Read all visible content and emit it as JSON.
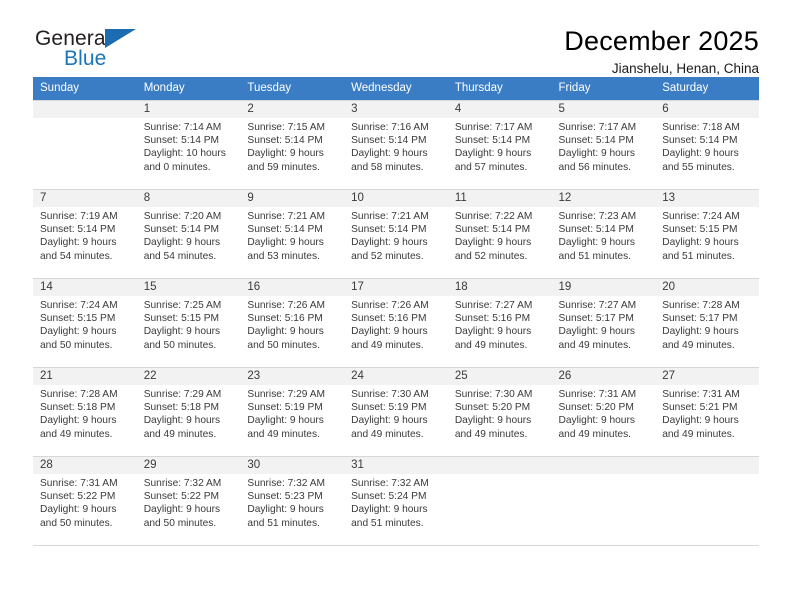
{
  "brand": {
    "name_part1": "General",
    "name_part2": "Blue",
    "flag_icon": "triangle-flag-icon"
  },
  "header": {
    "title": "December 2025",
    "subtitle": "Jianshelu, Henan, China"
  },
  "colors": {
    "header_row_bg": "#3b7dc4",
    "daynum_bg": "#f2f2f2",
    "brand_blue": "#1b75bb",
    "grid_line": "#d7d7d7",
    "text": "#3a3a3a"
  },
  "calendar": {
    "weekday_headers": [
      "Sunday",
      "Monday",
      "Tuesday",
      "Wednesday",
      "Thursday",
      "Friday",
      "Saturday"
    ],
    "labels": {
      "sunrise": "Sunrise:",
      "sunset": "Sunset:",
      "daylight": "Daylight:"
    },
    "weeks": [
      [
        {
          "day": "",
          "sunrise": "",
          "sunset": "",
          "daylight_line1": "",
          "daylight_line2": ""
        },
        {
          "day": "1",
          "sunrise": "Sunrise: 7:14 AM",
          "sunset": "Sunset: 5:14 PM",
          "daylight_line1": "Daylight: 10 hours",
          "daylight_line2": "and 0 minutes."
        },
        {
          "day": "2",
          "sunrise": "Sunrise: 7:15 AM",
          "sunset": "Sunset: 5:14 PM",
          "daylight_line1": "Daylight: 9 hours",
          "daylight_line2": "and 59 minutes."
        },
        {
          "day": "3",
          "sunrise": "Sunrise: 7:16 AM",
          "sunset": "Sunset: 5:14 PM",
          "daylight_line1": "Daylight: 9 hours",
          "daylight_line2": "and 58 minutes."
        },
        {
          "day": "4",
          "sunrise": "Sunrise: 7:17 AM",
          "sunset": "Sunset: 5:14 PM",
          "daylight_line1": "Daylight: 9 hours",
          "daylight_line2": "and 57 minutes."
        },
        {
          "day": "5",
          "sunrise": "Sunrise: 7:17 AM",
          "sunset": "Sunset: 5:14 PM",
          "daylight_line1": "Daylight: 9 hours",
          "daylight_line2": "and 56 minutes."
        },
        {
          "day": "6",
          "sunrise": "Sunrise: 7:18 AM",
          "sunset": "Sunset: 5:14 PM",
          "daylight_line1": "Daylight: 9 hours",
          "daylight_line2": "and 55 minutes."
        }
      ],
      [
        {
          "day": "7",
          "sunrise": "Sunrise: 7:19 AM",
          "sunset": "Sunset: 5:14 PM",
          "daylight_line1": "Daylight: 9 hours",
          "daylight_line2": "and 54 minutes."
        },
        {
          "day": "8",
          "sunrise": "Sunrise: 7:20 AM",
          "sunset": "Sunset: 5:14 PM",
          "daylight_line1": "Daylight: 9 hours",
          "daylight_line2": "and 54 minutes."
        },
        {
          "day": "9",
          "sunrise": "Sunrise: 7:21 AM",
          "sunset": "Sunset: 5:14 PM",
          "daylight_line1": "Daylight: 9 hours",
          "daylight_line2": "and 53 minutes."
        },
        {
          "day": "10",
          "sunrise": "Sunrise: 7:21 AM",
          "sunset": "Sunset: 5:14 PM",
          "daylight_line1": "Daylight: 9 hours",
          "daylight_line2": "and 52 minutes."
        },
        {
          "day": "11",
          "sunrise": "Sunrise: 7:22 AM",
          "sunset": "Sunset: 5:14 PM",
          "daylight_line1": "Daylight: 9 hours",
          "daylight_line2": "and 52 minutes."
        },
        {
          "day": "12",
          "sunrise": "Sunrise: 7:23 AM",
          "sunset": "Sunset: 5:14 PM",
          "daylight_line1": "Daylight: 9 hours",
          "daylight_line2": "and 51 minutes."
        },
        {
          "day": "13",
          "sunrise": "Sunrise: 7:24 AM",
          "sunset": "Sunset: 5:15 PM",
          "daylight_line1": "Daylight: 9 hours",
          "daylight_line2": "and 51 minutes."
        }
      ],
      [
        {
          "day": "14",
          "sunrise": "Sunrise: 7:24 AM",
          "sunset": "Sunset: 5:15 PM",
          "daylight_line1": "Daylight: 9 hours",
          "daylight_line2": "and 50 minutes."
        },
        {
          "day": "15",
          "sunrise": "Sunrise: 7:25 AM",
          "sunset": "Sunset: 5:15 PM",
          "daylight_line1": "Daylight: 9 hours",
          "daylight_line2": "and 50 minutes."
        },
        {
          "day": "16",
          "sunrise": "Sunrise: 7:26 AM",
          "sunset": "Sunset: 5:16 PM",
          "daylight_line1": "Daylight: 9 hours",
          "daylight_line2": "and 50 minutes."
        },
        {
          "day": "17",
          "sunrise": "Sunrise: 7:26 AM",
          "sunset": "Sunset: 5:16 PM",
          "daylight_line1": "Daylight: 9 hours",
          "daylight_line2": "and 49 minutes."
        },
        {
          "day": "18",
          "sunrise": "Sunrise: 7:27 AM",
          "sunset": "Sunset: 5:16 PM",
          "daylight_line1": "Daylight: 9 hours",
          "daylight_line2": "and 49 minutes."
        },
        {
          "day": "19",
          "sunrise": "Sunrise: 7:27 AM",
          "sunset": "Sunset: 5:17 PM",
          "daylight_line1": "Daylight: 9 hours",
          "daylight_line2": "and 49 minutes."
        },
        {
          "day": "20",
          "sunrise": "Sunrise: 7:28 AM",
          "sunset": "Sunset: 5:17 PM",
          "daylight_line1": "Daylight: 9 hours",
          "daylight_line2": "and 49 minutes."
        }
      ],
      [
        {
          "day": "21",
          "sunrise": "Sunrise: 7:28 AM",
          "sunset": "Sunset: 5:18 PM",
          "daylight_line1": "Daylight: 9 hours",
          "daylight_line2": "and 49 minutes."
        },
        {
          "day": "22",
          "sunrise": "Sunrise: 7:29 AM",
          "sunset": "Sunset: 5:18 PM",
          "daylight_line1": "Daylight: 9 hours",
          "daylight_line2": "and 49 minutes."
        },
        {
          "day": "23",
          "sunrise": "Sunrise: 7:29 AM",
          "sunset": "Sunset: 5:19 PM",
          "daylight_line1": "Daylight: 9 hours",
          "daylight_line2": "and 49 minutes."
        },
        {
          "day": "24",
          "sunrise": "Sunrise: 7:30 AM",
          "sunset": "Sunset: 5:19 PM",
          "daylight_line1": "Daylight: 9 hours",
          "daylight_line2": "and 49 minutes."
        },
        {
          "day": "25",
          "sunrise": "Sunrise: 7:30 AM",
          "sunset": "Sunset: 5:20 PM",
          "daylight_line1": "Daylight: 9 hours",
          "daylight_line2": "and 49 minutes."
        },
        {
          "day": "26",
          "sunrise": "Sunrise: 7:31 AM",
          "sunset": "Sunset: 5:20 PM",
          "daylight_line1": "Daylight: 9 hours",
          "daylight_line2": "and 49 minutes."
        },
        {
          "day": "27",
          "sunrise": "Sunrise: 7:31 AM",
          "sunset": "Sunset: 5:21 PM",
          "daylight_line1": "Daylight: 9 hours",
          "daylight_line2": "and 49 minutes."
        }
      ],
      [
        {
          "day": "28",
          "sunrise": "Sunrise: 7:31 AM",
          "sunset": "Sunset: 5:22 PM",
          "daylight_line1": "Daylight: 9 hours",
          "daylight_line2": "and 50 minutes."
        },
        {
          "day": "29",
          "sunrise": "Sunrise: 7:32 AM",
          "sunset": "Sunset: 5:22 PM",
          "daylight_line1": "Daylight: 9 hours",
          "daylight_line2": "and 50 minutes."
        },
        {
          "day": "30",
          "sunrise": "Sunrise: 7:32 AM",
          "sunset": "Sunset: 5:23 PM",
          "daylight_line1": "Daylight: 9 hours",
          "daylight_line2": "and 51 minutes."
        },
        {
          "day": "31",
          "sunrise": "Sunrise: 7:32 AM",
          "sunset": "Sunset: 5:24 PM",
          "daylight_line1": "Daylight: 9 hours",
          "daylight_line2": "and 51 minutes."
        },
        {
          "day": "",
          "sunrise": "",
          "sunset": "",
          "daylight_line1": "",
          "daylight_line2": ""
        },
        {
          "day": "",
          "sunrise": "",
          "sunset": "",
          "daylight_line1": "",
          "daylight_line2": ""
        },
        {
          "day": "",
          "sunrise": "",
          "sunset": "",
          "daylight_line1": "",
          "daylight_line2": ""
        }
      ]
    ]
  }
}
